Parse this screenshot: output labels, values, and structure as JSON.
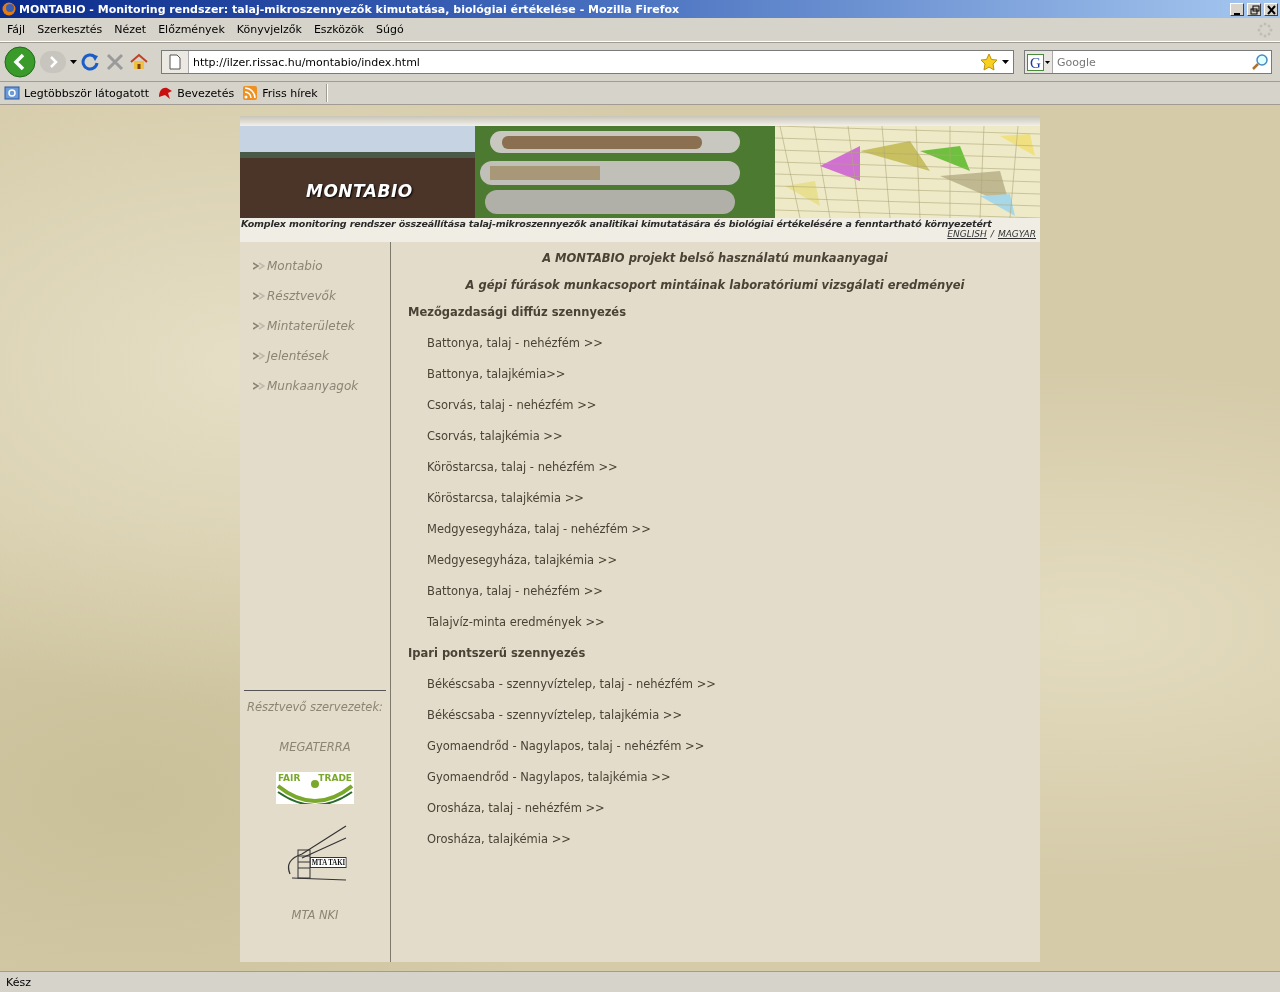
{
  "window": {
    "title": "MONTABIO - Monitoring rendszer: talaj-mikroszennyezők kimutatása, biológiai értékelése - Mozilla Firefox"
  },
  "menu": [
    "Fájl",
    "Szerkesztés",
    "Nézet",
    "Előzmények",
    "Könyvjelzők",
    "Eszközök",
    "Súgó"
  ],
  "navigation": {
    "url": "http://ilzer.rissac.hu/montabio/index.html",
    "search_placeholder": "Google",
    "search_engine_icon": "G"
  },
  "bookmarks": [
    "Legtöbbször látogatott",
    "Bevezetés",
    "Friss hírek"
  ],
  "page": {
    "banner_title": "MONTABIO",
    "tagline": "Komplex monitoring rendszer összeállítása talaj-mikroszennyezők analitikai kimutatására és biológiai értékelésére a fenntartható környezetért",
    "languages": [
      "ENGLISH",
      "MAGYAR"
    ],
    "language_separator": "/",
    "sidebar": {
      "items": [
        "Montabio",
        "Résztvevők",
        "Mintaterületek",
        "Jelentések",
        "Munkaanyagok"
      ],
      "partners_heading": "Résztvevő szervezetek:",
      "partners": [
        {
          "kind": "text",
          "label": "MEGATERRA"
        },
        {
          "kind": "fairtrade",
          "words": [
            "FAIR",
            "TRADE"
          ]
        },
        {
          "kind": "taki",
          "label": "MTA TAKI"
        },
        {
          "kind": "text",
          "label": "MTA NKI"
        }
      ]
    },
    "main": {
      "headings": [
        "A MONTABIO projekt belső használatú munkaanyagai",
        "A gépi fúrások munkacsoport mintáinak laboratóriumi vizsgálati eredményei"
      ],
      "sections": [
        {
          "title": "Mezőgazdasági diffúz szennyezés",
          "links": [
            "Battonya, talaj - nehézfém >>",
            "Battonya, talajkémia>>",
            "Csorvás, talaj - nehézfém >>",
            "Csorvás, talajkémia >>",
            "Köröstarcsa, talaj - nehézfém >>",
            "Köröstarcsa, talajkémia >>",
            "Medgyesegyháza, talaj - nehézfém >>",
            "Medgyesegyháza, talajkémia >>",
            "Battonya, talaj - nehézfém >>",
            "Talajvíz-minta eredmények >>"
          ]
        },
        {
          "title": "Ipari pontszerű szennyezés",
          "links": [
            "Békéscsaba - szennyvíztelep, talaj - nehézfém >>",
            "Békéscsaba - szennyvíztelep, talajkémia >>",
            "Gyomaendrőd - Nagylapos, talaj - nehézfém >>",
            "Gyomaendrőd - Nagylapos, talajkémia >>",
            "Orosháza, talaj - nehézfém >>",
            "Orosháza, talajkémia >>"
          ]
        }
      ]
    }
  },
  "status_bar": "Kész"
}
